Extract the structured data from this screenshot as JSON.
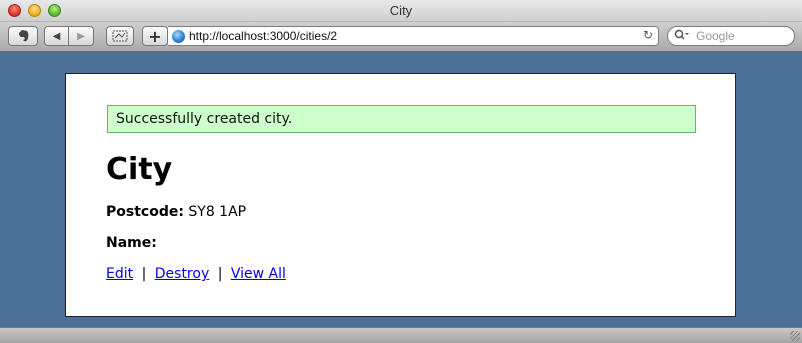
{
  "window": {
    "title": "City"
  },
  "toolbar": {
    "evernote_icon": "evernote-icon",
    "back_glyph": "◀",
    "forward_glyph": "▶",
    "add_glyph": "+",
    "address_url": "http://localhost:3000/cities/2",
    "reload_glyph": "↻",
    "search_placeholder": "Google"
  },
  "page": {
    "flash_notice": "Successfully created city.",
    "heading": "City",
    "postcode_label": "Postcode:",
    "postcode_value": "SY8 1AP",
    "name_label": "Name:",
    "name_value": "",
    "links": {
      "edit": "Edit",
      "destroy": "Destroy",
      "view_all": "View All",
      "separator": "|"
    }
  },
  "colors": {
    "desktop_background": "#4a7098",
    "notice_background": "#ccffcc",
    "notice_border": "#6bb56b",
    "link": "#0000ee"
  }
}
